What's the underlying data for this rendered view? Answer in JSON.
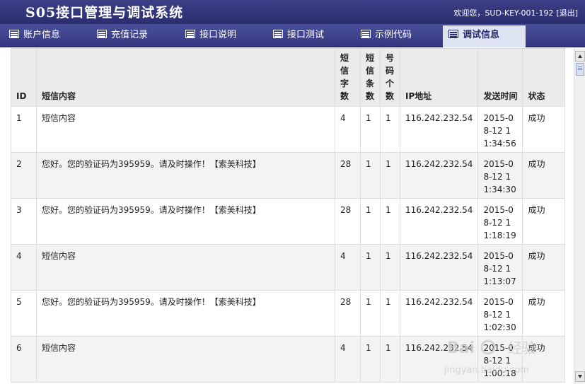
{
  "app": {
    "title": "S05接口管理与调试系统"
  },
  "user": {
    "welcome": "欢迎您，SUD-KEY-001-192",
    "logout": "[退出]"
  },
  "nav": {
    "tabs": [
      {
        "label": "账户信息",
        "icon": "list-icon",
        "active": false
      },
      {
        "label": "充值记录",
        "icon": "list-icon",
        "active": false
      },
      {
        "label": "接口说明",
        "icon": "list-icon",
        "active": false
      },
      {
        "label": "接口测试",
        "icon": "list-icon",
        "active": false
      },
      {
        "label": "示例代码",
        "icon": "list-icon",
        "active": false
      },
      {
        "label": "调试信息",
        "icon": "list-icon",
        "active": true
      }
    ]
  },
  "table": {
    "headers": [
      "ID",
      "短信内容",
      "短信字数",
      "短信条数",
      "号码个数",
      "IP地址",
      "发送时间",
      "状态"
    ],
    "rows": [
      {
        "id": "1",
        "content": "短信内容",
        "chars": "4",
        "count": "1",
        "numbers": "1",
        "ip": "116.242.232.54",
        "time": "2015-08-12 11:34:56",
        "status": "成功"
      },
      {
        "id": "2",
        "content": "您好。您的验证码为395959。请及时操作！【索美科技】",
        "chars": "28",
        "count": "1",
        "numbers": "1",
        "ip": "116.242.232.54",
        "time": "2015-08-12 11:34:30",
        "status": "成功"
      },
      {
        "id": "3",
        "content": "您好。您的验证码为395959。请及时操作！【索美科技】",
        "chars": "28",
        "count": "1",
        "numbers": "1",
        "ip": "116.242.232.54",
        "time": "2015-08-12 11:18:19",
        "status": "成功"
      },
      {
        "id": "4",
        "content": "短信内容",
        "chars": "4",
        "count": "1",
        "numbers": "1",
        "ip": "116.242.232.54",
        "time": "2015-08-12 11:13:07",
        "status": "成功"
      },
      {
        "id": "5",
        "content": "您好。您的验证码为395959。请及时操作！【索美科技】",
        "chars": "28",
        "count": "1",
        "numbers": "1",
        "ip": "116.242.232.54",
        "time": "2015-08-12 11:02:30",
        "status": "成功"
      },
      {
        "id": "6",
        "content": "短信内容",
        "chars": "4",
        "count": "1",
        "numbers": "1",
        "ip": "116.242.232.54",
        "time": "2015-08-12 11:00:18",
        "status": "成功"
      }
    ]
  },
  "watermark": {
    "text1": "Bai",
    "text2": "经验",
    "text3": "jingyan.baidu.com"
  },
  "colors": {
    "header": "#2a2d6e",
    "nav": "#3b3f86",
    "active_tab": "#dfe4f3",
    "row_alt": "#f3f3f3",
    "header_row": "#ebebeb"
  }
}
